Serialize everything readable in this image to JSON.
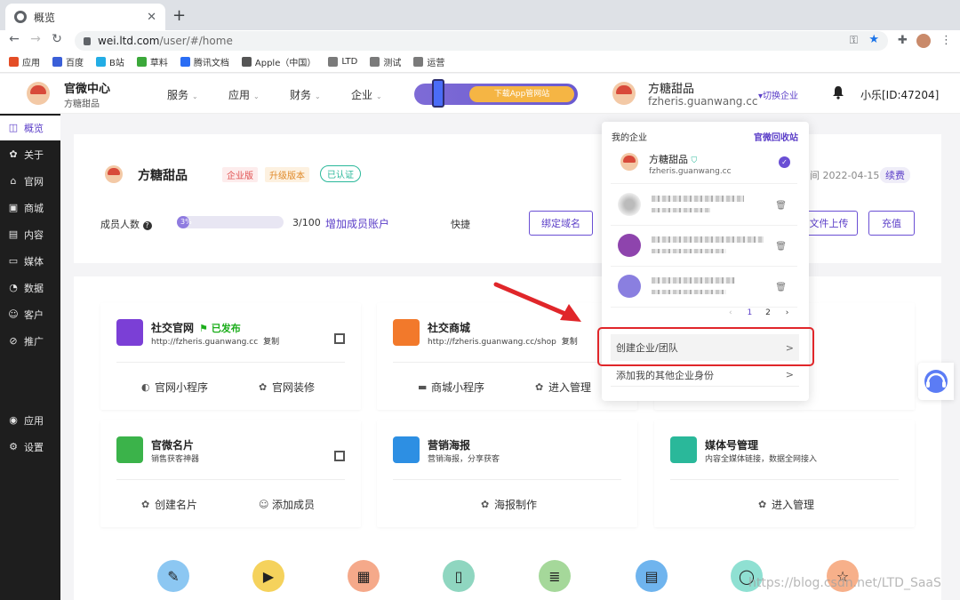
{
  "browser": {
    "tab_title": "概览",
    "new_tab_symbol": "+",
    "close_symbol": "✕",
    "url_host": "wei.ltd.com",
    "url_path": "/user/#/home",
    "bookmarks": [
      {
        "label": "应用",
        "color": "#e44d26"
      },
      {
        "label": "百度",
        "color": "#3a5fd8"
      },
      {
        "label": "B站",
        "color": "#23ade5"
      },
      {
        "label": "草料",
        "color": "#3ba83a"
      },
      {
        "label": "腾讯文档",
        "color": "#2a6df4"
      },
      {
        "label": "Apple（中国）",
        "color": "#555555"
      },
      {
        "label": "LTD",
        "color": "#7a7a7a"
      },
      {
        "label": "测试",
        "color": "#7a7a7a"
      },
      {
        "label": "运营",
        "color": "#7a7a7a"
      }
    ]
  },
  "header": {
    "brand_title": "官微中心",
    "brand_sub": "方糖甜品",
    "nav": [
      "服务",
      "应用",
      "财务",
      "企业"
    ],
    "promo_cta": "下载App管网站 ",
    "company_name": "方糖甜品",
    "company_domain": "fzheris.guanwang.cc",
    "switch_label": "▾切换企业",
    "user": "小乐[ID:47204]"
  },
  "sidebar": {
    "top": [
      {
        "icon": "◫",
        "label": "概览",
        "name": "overview"
      },
      {
        "icon": "✿",
        "label": "关于",
        "name": "about"
      },
      {
        "icon": "⌂",
        "label": "官网",
        "name": "website"
      },
      {
        "icon": "▣",
        "label": "商城",
        "name": "mall"
      },
      {
        "icon": "▤",
        "label": "内容",
        "name": "content"
      },
      {
        "icon": "▭",
        "label": "媒体",
        "name": "media"
      },
      {
        "icon": "◔",
        "label": "数据",
        "name": "data"
      },
      {
        "icon": "☺",
        "label": "客户",
        "name": "customer"
      },
      {
        "icon": "⊘",
        "label": "推广",
        "name": "promote"
      }
    ],
    "bottom": [
      {
        "icon": "◉",
        "label": "应用",
        "name": "apps"
      },
      {
        "icon": "⚙",
        "label": "设置",
        "name": "settings"
      }
    ]
  },
  "company_panel": {
    "name": "方糖甜品",
    "badges": [
      "企业版",
      "升级版本",
      "已认证"
    ],
    "members_label": "成员人数",
    "progress_text": "3%",
    "progress_fraction": 0.03,
    "members_count": "3/100",
    "add_members": "增加成员账户",
    "quick_label": "快捷",
    "bind_domain": "绑定域名",
    "expire_text": "间 2022-04-15",
    "renew": "续费",
    "upload": "文件上传",
    "recharge": "充值"
  },
  "cards": [
    {
      "name": "social-website",
      "title": "社交官网",
      "sub": "http://fzheris.guanwang.cc",
      "copy": "复制",
      "published": "发布",
      "color": "#7b3fd6",
      "actions": [
        {
          "icon": "◐",
          "label": "官网小程序"
        },
        {
          "icon": "✿",
          "label": "官网装修"
        }
      ]
    },
    {
      "name": "social-mall",
      "title": "社交商城",
      "sub": "http://fzheris.guanwang.cc/shop",
      "copy": "复制",
      "color": "#f2792b",
      "actions": [
        {
          "icon": "▬",
          "label": "商城小程序"
        },
        {
          "icon": "✿",
          "label": "进入管理"
        }
      ]
    },
    {
      "name": "business-card",
      "title": "官微名片",
      "sub": "销售获客神器",
      "color": "#3bb34a",
      "actions": [
        {
          "icon": "✿",
          "label": "创建名片"
        },
        {
          "icon": "☺",
          "label": "添加成员"
        }
      ]
    },
    {
      "name": "poster",
      "title": "营销海报",
      "sub": "营销海报，分享获客",
      "color": "#2d8fe3",
      "actions": [
        {
          "icon": "✿",
          "label": "海报制作"
        }
      ]
    },
    {
      "name": "media-account",
      "title": "媒体号管理",
      "sub": "内容全媒体链接，数据全网接入",
      "color": "#2ab89a",
      "actions": [
        {
          "icon": "✿",
          "label": "进入管理"
        }
      ]
    }
  ],
  "quick_icons": [
    {
      "name": "edit",
      "glyph": "✎",
      "color": "#8cc7f2"
    },
    {
      "name": "play",
      "glyph": "▶",
      "color": "#f5d25c"
    },
    {
      "name": "box",
      "glyph": "▦",
      "color": "#f5a98a"
    },
    {
      "name": "book",
      "glyph": "▯",
      "color": "#8fd6c0"
    },
    {
      "name": "doc",
      "glyph": "≣",
      "color": "#a5d89a"
    },
    {
      "name": "inbox",
      "glyph": "▤",
      "color": "#6fb4ee"
    },
    {
      "name": "search",
      "glyph": "◯",
      "color": "#8fe0d2"
    },
    {
      "name": "star",
      "glyph": "☆",
      "color": "#f7b08a"
    }
  ],
  "dropdown": {
    "title": "我的企业",
    "recycle": "官微回收站",
    "current": {
      "name": "方糖甜品",
      "domain": "fzheris.guanwang.cc"
    },
    "pager": {
      "prev": "‹",
      "pages": [
        "1",
        "2"
      ],
      "next": "›"
    },
    "create": "创建企业/团队",
    "add_other": "添加我的其他企业身份",
    "arrow": ">"
  },
  "watermark": "https://blog.csdn.net/LTD_SaaS"
}
